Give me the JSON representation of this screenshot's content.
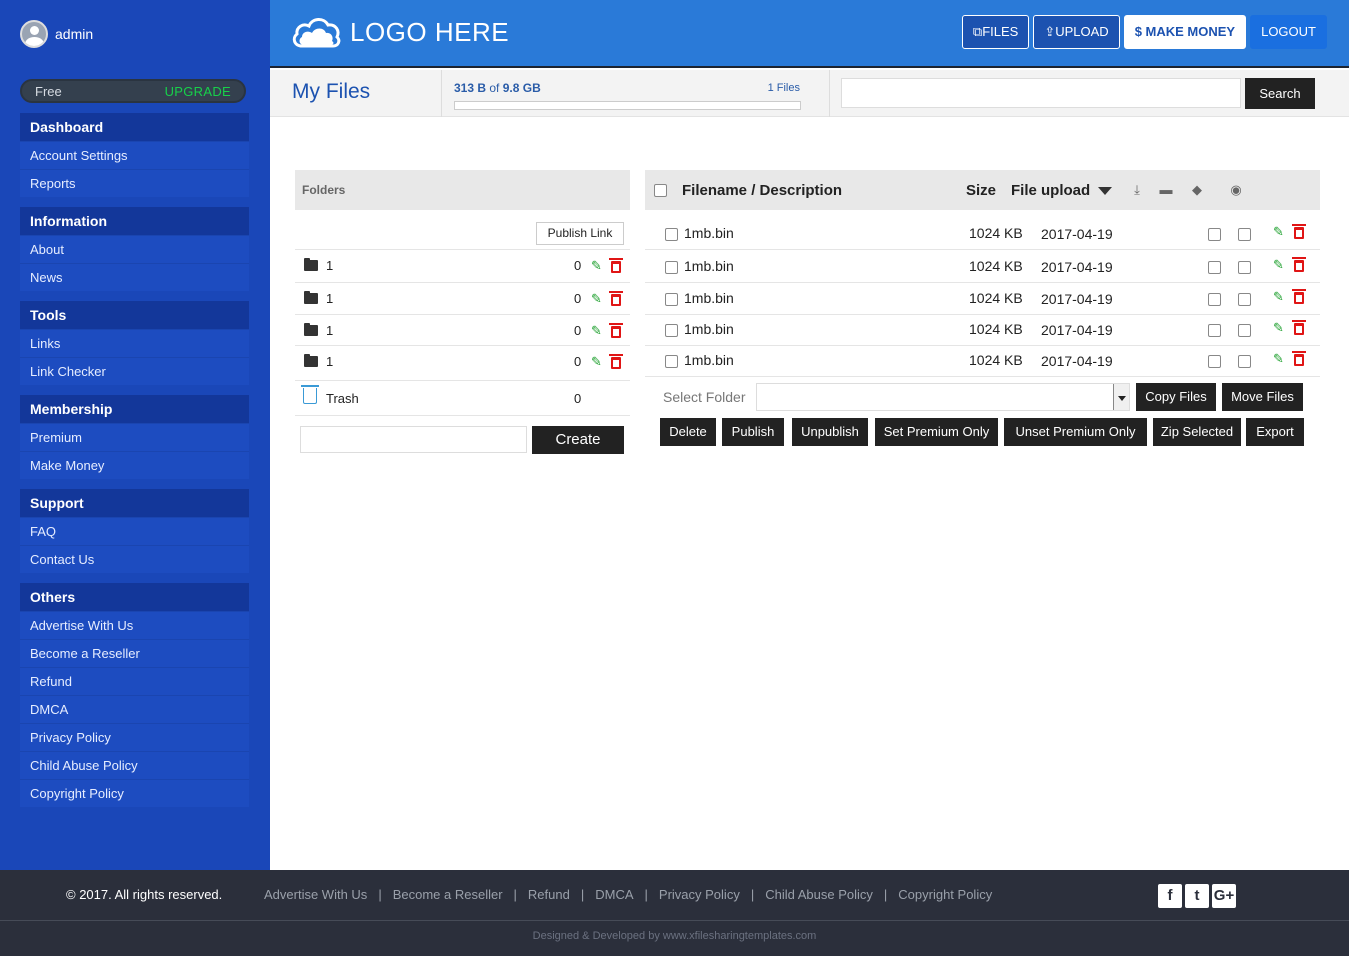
{
  "user": {
    "name": "admin"
  },
  "plan": {
    "label": "Free",
    "upgrade": "UPGRADE"
  },
  "nav": [
    {
      "heading": "Dashboard",
      "items": [
        "Account Settings",
        "Reports"
      ]
    },
    {
      "heading": "Information",
      "items": [
        "About",
        "News"
      ]
    },
    {
      "heading": "Tools",
      "items": [
        "Links",
        "Link Checker"
      ]
    },
    {
      "heading": "Membership",
      "items": [
        "Premium",
        "Make Money"
      ]
    },
    {
      "heading": "Support",
      "items": [
        "FAQ",
        "Contact Us"
      ]
    },
    {
      "heading": "Others",
      "items": [
        "Advertise With Us",
        "Become a Reseller",
        "Refund",
        "DMCA",
        "Privacy Policy",
        "Child Abuse Policy",
        "Copyright Policy"
      ]
    }
  ],
  "header": {
    "logo": "LOGO HERE",
    "files": "FILES",
    "upload": "UPLOAD",
    "money": "$ MAKE MONEY",
    "logout": "LOGOUT"
  },
  "subbar": {
    "title": "My Files",
    "used": "313 B",
    "of": "of",
    "total": "9.8 GB",
    "count": "1 Files",
    "usage_fraction": 0.0,
    "search_label": "Search"
  },
  "folders": {
    "header": "Folders",
    "publish": "Publish Link",
    "rows": [
      {
        "name": "1",
        "count": "0"
      },
      {
        "name": "1",
        "count": "0"
      },
      {
        "name": "1",
        "count": "0"
      },
      {
        "name": "1",
        "count": "0"
      }
    ],
    "trash": {
      "name": "Trash",
      "count": "0"
    },
    "create": "Create"
  },
  "files": {
    "headers": {
      "name": "Filename / Description",
      "size": "Size",
      "upload": "File upload"
    },
    "rows": [
      {
        "name": "1mb.bin",
        "size": "1024 KB",
        "date": "2017-04-19"
      },
      {
        "name": "1mb.bin",
        "size": "1024 KB",
        "date": "2017-04-19"
      },
      {
        "name": "1mb.bin",
        "size": "1024 KB",
        "date": "2017-04-19"
      },
      {
        "name": "1mb.bin",
        "size": "1024 KB",
        "date": "2017-04-19"
      },
      {
        "name": "1mb.bin",
        "size": "1024 KB",
        "date": "2017-04-19"
      }
    ],
    "select_folder": "Select Folder",
    "copy": "Copy Files",
    "move": "Move Files",
    "actions": [
      "Delete",
      "Publish",
      "Unpublish",
      "Set Premium Only",
      "Unset Premium Only",
      "Zip Selected",
      "Export"
    ]
  },
  "footer": {
    "copyright": "© 2017. All rights reserved.",
    "links": [
      "Advertise With Us",
      "Become a Reseller",
      "Refund",
      "DMCA",
      "Privacy Policy",
      "Child Abuse Policy",
      "Copyright Policy"
    ],
    "credit": "Designed & Developed by www.xfilesharingtemplates.com"
  },
  "colors": {
    "sidebar": "#1a47b8",
    "header": "#2a7ad8",
    "footer": "#2b2f3b",
    "edit": "#1a9e2a",
    "delete": "#e01515"
  }
}
